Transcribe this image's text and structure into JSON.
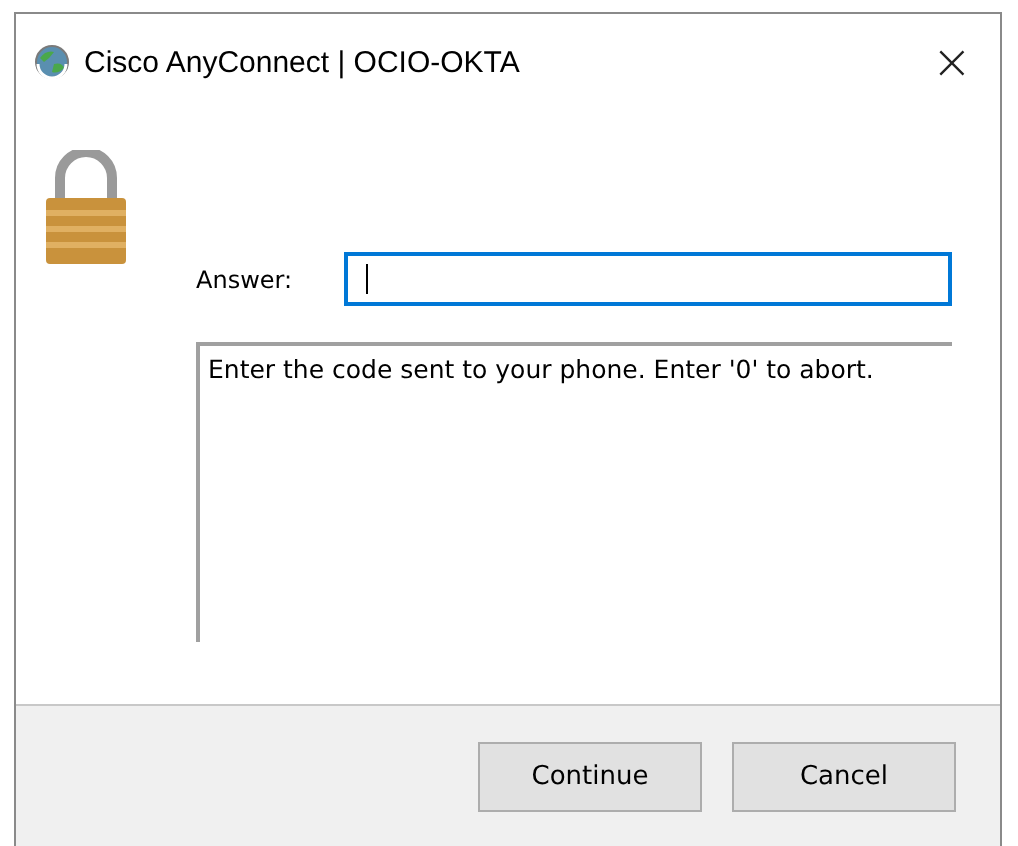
{
  "window": {
    "title": "Cisco AnyConnect | OCIO-OKTA",
    "close": "×"
  },
  "answer": {
    "label": "Answer:",
    "focused": true
  },
  "message": "Enter the code sent to your phone. Enter '0' to abort.",
  "buttons": [
    "Continue",
    "Cancel"
  ]
}
